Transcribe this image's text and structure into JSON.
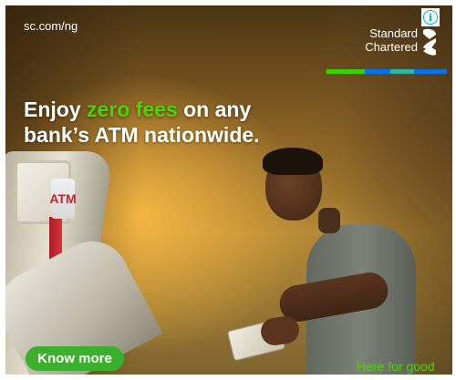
{
  "ad": {
    "url": "sc.com/ng",
    "brand": {
      "line1": "Standard",
      "line2": "Chartered"
    },
    "headline": {
      "part1": "Enjoy ",
      "highlight": "zero fees",
      "part2": " on any",
      "line2": "bank’s ATM nationwide."
    },
    "atm_sign": "ATM",
    "cta_label": "Know more",
    "tagline": "Here for good",
    "info_icon": "i"
  },
  "colors": {
    "brand_green": "#38d200",
    "brand_blue": "#0473ea",
    "brand_teal": "#2ab5a6",
    "cta_green": "#3ab02c",
    "info_cyan": "#00aecd"
  },
  "icons": {
    "brand_logo": "standard-chartered-logo-icon",
    "info": "info-icon"
  }
}
